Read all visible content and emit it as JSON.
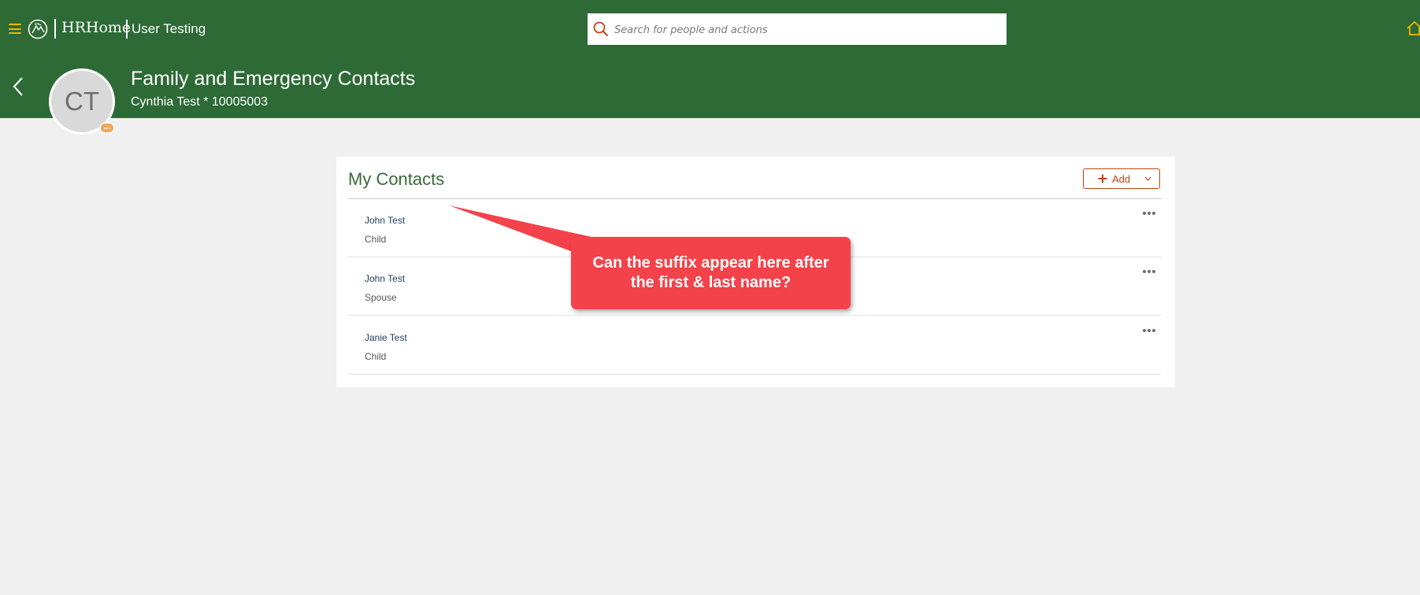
{
  "app": {
    "name": "HRHome",
    "environment": "User Testing",
    "brand_color": "#2d6a36",
    "accent_color": "#f0b400"
  },
  "search": {
    "placeholder": "Search for people and actions",
    "icon": "search-icon"
  },
  "header": {
    "title": "Family and Emergency Contacts",
    "subtitle": "Cynthia Test * 10005003",
    "avatar_initials": "CT",
    "back_icon": "chevron-left-icon"
  },
  "contacts": {
    "title": "My Contacts",
    "add_label": "Add",
    "action_color": "#c0430f",
    "rows": [
      {
        "name": "John Test",
        "relation": "Child"
      },
      {
        "name": "John Test",
        "relation": "Spouse"
      },
      {
        "name": "Janie Test",
        "relation": "Child"
      }
    ]
  },
  "annotation": {
    "text": "Can the suffix appear here after the first & last name?",
    "color": "#f4424a"
  }
}
